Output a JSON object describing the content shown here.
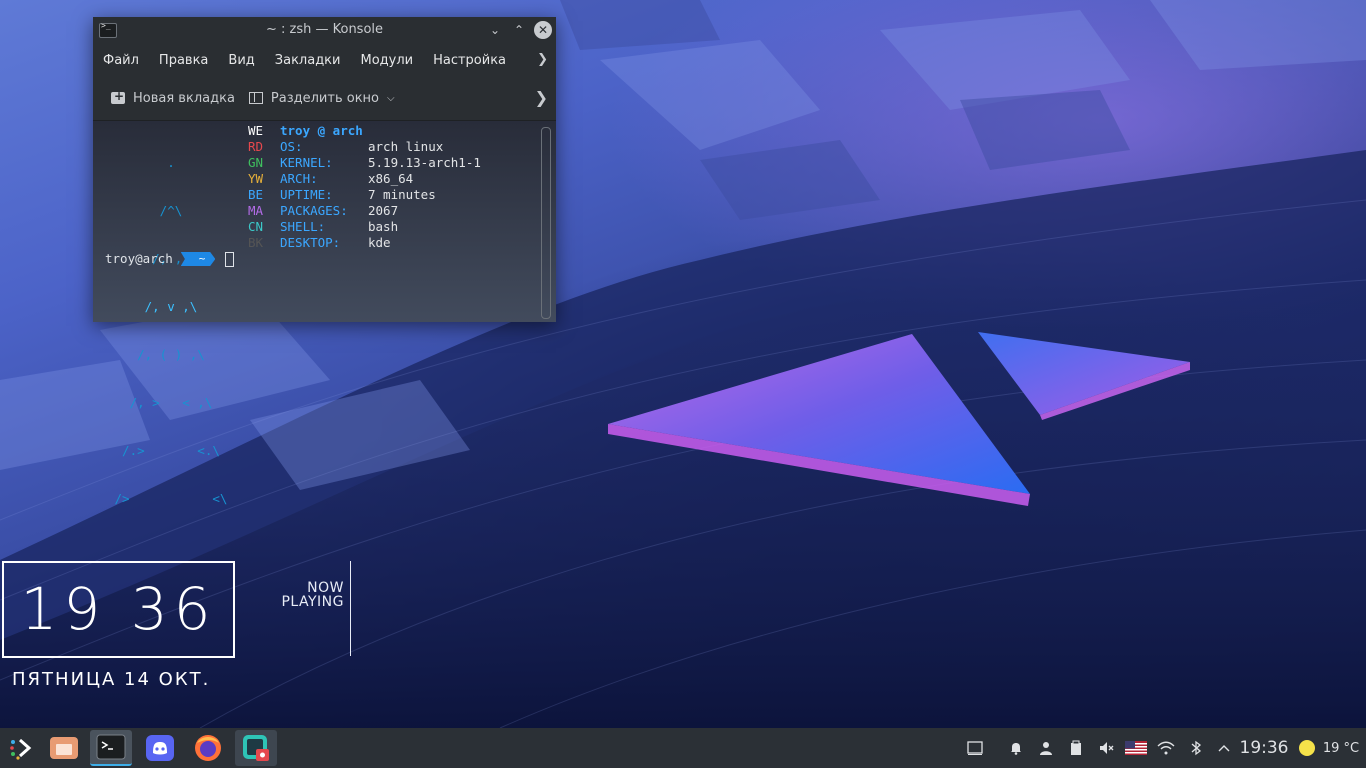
{
  "window": {
    "title": "~ : zsh — Konsole",
    "menu": [
      "Файл",
      "Правка",
      "Вид",
      "Закладки",
      "Модули",
      "Настройка"
    ],
    "toolbar": {
      "new_tab": "Новая вкладка",
      "split": "Разделить окно"
    }
  },
  "terminal": {
    "logo_lines": [
      "        .",
      "       /^\\",
      "      /, ,\\",
      "     /, v ,\\",
      "    /, ( ) ,\\",
      "   /, >   < ,\\",
      "  /.>       <.\\",
      " />           <\\"
    ],
    "tags": [
      "WE",
      "RD",
      "GN",
      "YW",
      "BE",
      "MA",
      "CN",
      "BK"
    ],
    "tag_colors": [
      "#ffffff",
      "#e5484d",
      "#3fbf5f",
      "#e8b13a",
      "#3ba7ff",
      "#b46ce8",
      "#3bc8c8",
      "#555555"
    ],
    "header": "troy @ arch",
    "rows": [
      {
        "key": "OS:",
        "value": "arch linux"
      },
      {
        "key": "KERNEL:",
        "value": "5.19.13-arch1-1"
      },
      {
        "key": "ARCH:",
        "value": "x86_64"
      },
      {
        "key": "UPTIME:",
        "value": "7 minutes"
      },
      {
        "key": "PACKAGES:",
        "value": "2067"
      },
      {
        "key": "SHELL:",
        "value": "bash"
      },
      {
        "key": "DESKTOP:",
        "value": "kde"
      }
    ],
    "prompt_user": "troy@arch",
    "prompt_dir": "~"
  },
  "clock": {
    "time": "19 36",
    "date": "ПЯТНИЦА 14 ОКТ."
  },
  "now_playing": {
    "line1": "NOW",
    "line2": "PLAYING"
  },
  "panel": {
    "apps": [
      "app-launcher",
      "file-manager",
      "konsole",
      "discord",
      "firefox",
      "spectacle"
    ],
    "time": "19:36",
    "weather": "19 °C"
  }
}
